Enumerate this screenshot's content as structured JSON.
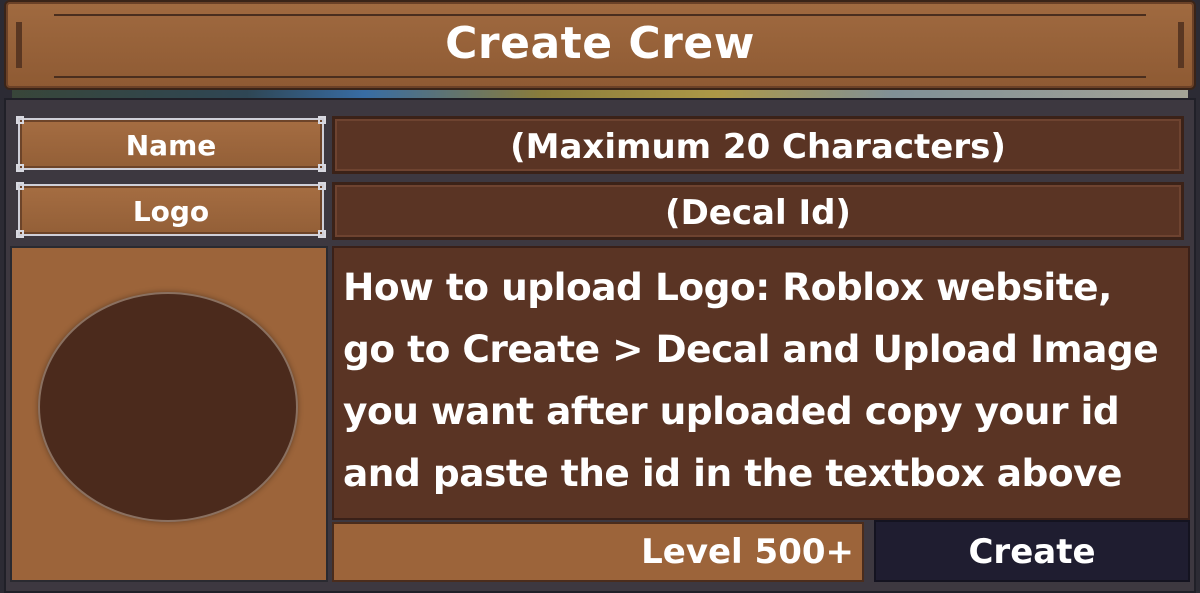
{
  "window": {
    "title": "Create Crew"
  },
  "form": {
    "name_label": "Name",
    "name_placeholder": "(Maximum 20 Characters)",
    "logo_label": "Logo",
    "logo_placeholder": "(Decal Id)"
  },
  "instructions": {
    "text": "How to upload Logo: Roblox website,\ngo to Create > Decal and Upload Image\nyou want after uploaded copy your id\nand paste the id in the textbox above"
  },
  "footer": {
    "level_requirement": "Level 500+",
    "create_label": "Create"
  },
  "colors": {
    "panel_brown": "#9c643a",
    "field_dark_brown": "#5a3424",
    "logo_circle": "#4b2a1c",
    "create_button": "#1f1d30"
  }
}
